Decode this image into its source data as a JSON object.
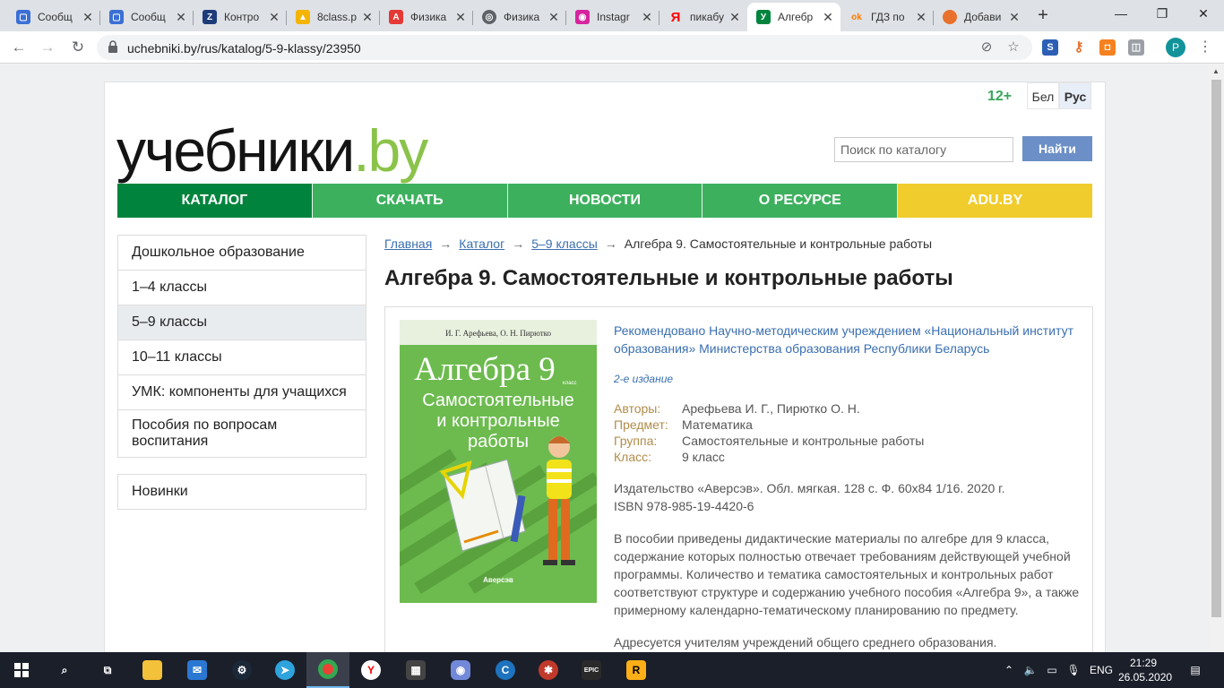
{
  "browser": {
    "tabs": [
      {
        "title": "Сообщ",
        "icon": "chat-icon",
        "color": "#3b6fd4"
      },
      {
        "title": "Сообщ",
        "icon": "chat-icon",
        "color": "#3b6fd4"
      },
      {
        "title": "Контро",
        "icon": "z-icon",
        "color": "#1d3c7a"
      },
      {
        "title": "8class.p",
        "icon": "drive-icon",
        "color": "#f4b400"
      },
      {
        "title": "Физика",
        "icon": "pdf-icon",
        "color": "#e53935"
      },
      {
        "title": "Физика",
        "icon": "globe-icon",
        "color": "#5f6368"
      },
      {
        "title": "Instagr",
        "icon": "instagram-icon",
        "color": "#d6249f"
      },
      {
        "title": "пикабу",
        "icon": "yandex-icon",
        "color": "#ff0000"
      },
      {
        "title": "Алгебр",
        "icon": "uchebniki-icon",
        "color": "#00843d"
      },
      {
        "title": "ГДЗ по",
        "icon": "gdz-icon",
        "color": "#ff7a00"
      },
      {
        "title": "Добави",
        "icon": "addon-icon",
        "color": "#e8712c"
      }
    ],
    "url": "uchebniki.by/rus/katalog/5-9-klassy/23950"
  },
  "site": {
    "age": "12+",
    "lang_bel": "Бел",
    "lang_rus": "Рус",
    "logo_main": "учебники",
    "logo_domain": ".by",
    "search_placeholder": "Поиск по каталогу",
    "search_button": "Найти",
    "nav": [
      {
        "label": "КАТАЛОГ",
        "color": "#00843d"
      },
      {
        "label": "СКАЧАТЬ",
        "color": "#3db05e"
      },
      {
        "label": "НОВОСТИ",
        "color": "#3db05e"
      },
      {
        "label": "О РЕСУРСЕ",
        "color": "#3db05e"
      },
      {
        "label": "ADU.BY",
        "color": "#f0cc2d"
      }
    ],
    "sidebar": [
      "Дошкольное образование",
      "1–4 классы",
      "5–9 классы",
      "10–11 классы",
      "УМК: компоненты для учащихся",
      "Пособия по вопросам воспитания"
    ],
    "sidebar_extra": "Новинки"
  },
  "main": {
    "breadcrumb": [
      "Главная",
      "Каталог",
      "5–9 классы",
      "Алгебра 9. Самостоятельные и контрольные работы"
    ],
    "title": "Алгебра 9. Самостоятельные и контрольные работы",
    "cover": {
      "authors": "И. Г. Арефьева, О. Н. Пирютко",
      "title": "Алгебра",
      "grade": "9",
      "grade_label": "класс",
      "subtitle_1": "Самостоятельные",
      "subtitle_2": "и контрольные",
      "subtitle_3": "работы",
      "publisher": "Аверсэв"
    },
    "recommended": "Рекомендовано Научно-методическим учреждением «Национальный институт образования» Министерства образования Республики Беларусь",
    "edition": "2-е издание",
    "props": [
      {
        "key": "Авторы:",
        "value": "Арефьева И. Г., Пирютко О. Н."
      },
      {
        "key": "Предмет:",
        "value": "Математика"
      },
      {
        "key": "Группа:",
        "value": "Самостоятельные и контрольные работы"
      },
      {
        "key": "Класс:",
        "value": "9 класс"
      }
    ],
    "publisher_info": "Издательство «Аверсэв». Обл. мягкая. 128 с. Ф. 60x84 1/16. 2020 г.",
    "isbn": "ISBN 978-985-19-4420-6",
    "description": "В пособии приведены дидактические материалы по алгебре для 9 класса, содержание которых полностью отвечает требованиям действующей учебной программы. Количество и тематика самостоятельных и контрольных работ соответствуют структуре и содержанию учебного пособия «Алгебра 9», а также примерному календарно-тематическому планированию по предмету.",
    "addressed": "Адресуется учителям учреждений общего среднего образования."
  },
  "taskbar": {
    "lang": "ENG",
    "time": "21:29",
    "date": "26.05.2020"
  }
}
